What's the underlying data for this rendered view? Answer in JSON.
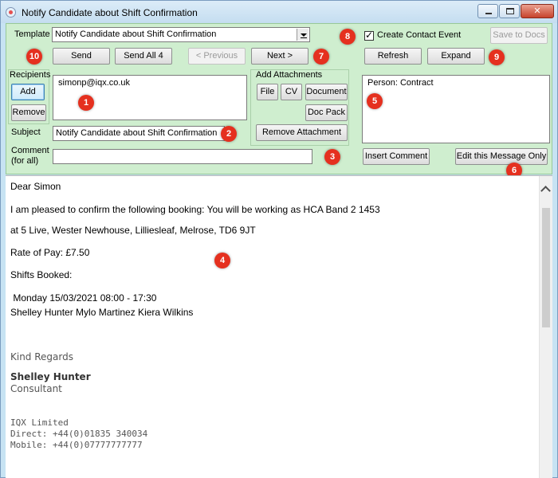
{
  "window": {
    "title": "Notify Candidate about Shift Confirmation",
    "min_glyph": "",
    "max_glyph": "",
    "close_glyph": "✕"
  },
  "template": {
    "label": "Template",
    "value": "Notify Candidate about Shift Confirmation"
  },
  "toolbar": {
    "send": "Send",
    "send_all": "Send All 4",
    "previous": "< Previous",
    "next": "Next >",
    "refresh": "Refresh",
    "expand": "Expand",
    "save_to_docs": "Save to Docs",
    "create_contact_event": "Create Contact Event",
    "create_contact_event_checked": true
  },
  "recipients": {
    "label": "Recipients",
    "add": "Add",
    "remove": "Remove",
    "list": [
      "simonp@iqx.co.uk"
    ]
  },
  "attachments": {
    "label": "Add Attachments",
    "file": "File",
    "cv": "CV",
    "document": "Document",
    "doc_pack": "Doc Pack",
    "remove": "Remove Attachment"
  },
  "person_box": {
    "text": "Person: Contract"
  },
  "subject": {
    "label": "Subject",
    "value": "Notify Candidate about Shift Confirmation"
  },
  "comment": {
    "label_line1": "Comment",
    "label_line2": "(for all)",
    "value": "",
    "insert": "Insert Comment",
    "edit_only": "Edit this Message Only"
  },
  "message": {
    "greeting": "Dear Simon",
    "line1": "I am pleased to confirm the following booking: You will be working as HCA Band 2 1453",
    "line2": "at 5 Live, Wester Newhouse, Lilliesleaf, Melrose, TD6 9JT",
    "rate": "Rate of Pay: £7.50",
    "shifts_header": "Shifts Booked:",
    "shift_date": " Monday 15/03/2021 08:00 - 17:30",
    "shift_people": "Shelley Hunter Mylo Martinez Kiera Wilkins",
    "regards": "Kind Regards",
    "sender_name": "Shelley Hunter",
    "sender_role": "Consultant",
    "company": "IQX Limited",
    "direct": "Direct: +44(0)01835 340034",
    "mobile": "Mobile: +44(0)07777777777"
  },
  "badges": [
    "1",
    "2",
    "3",
    "4",
    "5",
    "6",
    "7",
    "8",
    "9",
    "10"
  ],
  "colors": {
    "panel_bg": "#cfeecf",
    "badge_red": "#e5301f",
    "titlebar": "#c4ddf0"
  }
}
